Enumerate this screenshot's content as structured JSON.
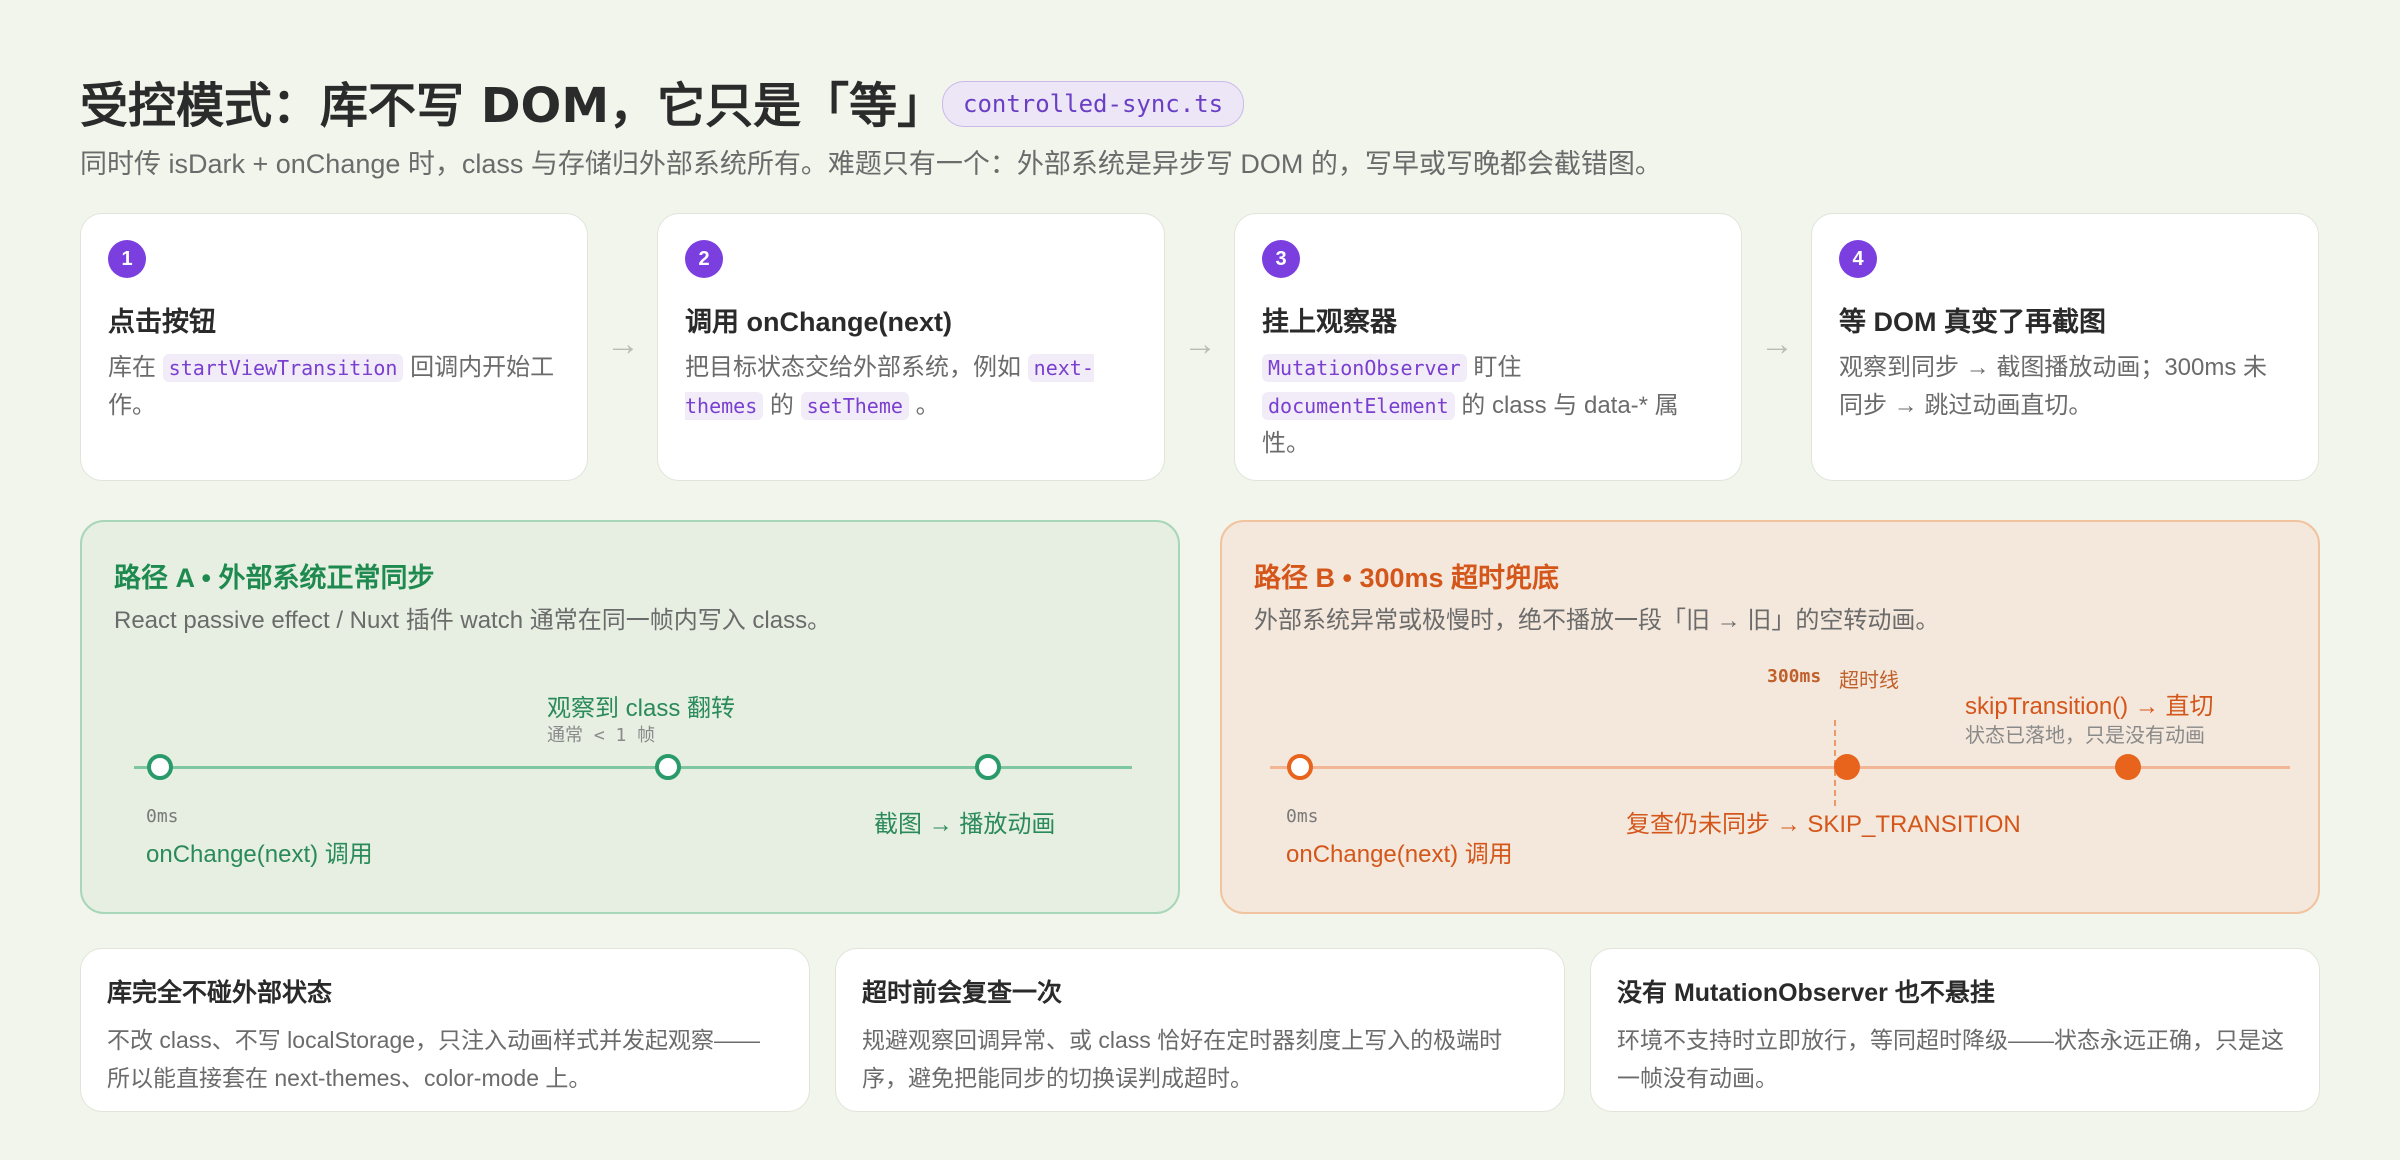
{
  "header": {
    "title": "受控模式：库不写 DOM，它只是「等」",
    "file_badge": "controlled-sync.ts",
    "subtitle": "同时传 isDark + onChange 时，class 与存储归外部系统所有。难题只有一个：外部系统是异步写 DOM 的，写早或写晚都会截错图。"
  },
  "steps": [
    {
      "num": "1",
      "title": "点击按钮",
      "desc": [
        "库在 ",
        {
          "code": "startViewTransition"
        },
        " 回调内开始工作。"
      ]
    },
    {
      "num": "2",
      "title": "调用 onChange(next)",
      "desc": [
        "把目标状态交给外部系统，例如 ",
        {
          "code": "next-themes"
        },
        " 的 ",
        {
          "code": "setTheme"
        },
        " 。"
      ]
    },
    {
      "num": "3",
      "title": "挂上观察器",
      "desc": [
        {
          "code": "MutationObserver"
        },
        " 盯住 ",
        {
          "code": "documentElement"
        },
        " 的 class 与 data-* 属性。"
      ]
    },
    {
      "num": "4",
      "title": "等 DOM 真变了再截图",
      "desc": [
        "观察到同步 → 截图播放动画；300ms 未同步 → 跳过动画直切。"
      ]
    }
  ],
  "arrow_glyph": "→",
  "path_a": {
    "title": "路径 A • 外部系统正常同步",
    "desc": "React passive effect / Nuxt 插件 watch 通常在同一帧内写入 class。",
    "start_time": "0ms",
    "start_label": "onChange(next) 调用",
    "mid_label": "观察到 class 翻转",
    "mid_sub": "通常 < 1 帧",
    "end_label": "截图 → 播放动画",
    "color": "#2a8a5a",
    "line_color": "#7fc7a0"
  },
  "path_b": {
    "title": "路径 B • 300ms 超时兜底",
    "desc": "外部系统异常或极慢时，绝不播放一段「旧 → 旧」的空转动画。",
    "timeout_mono": "300ms",
    "timeout_text": "超时线",
    "start_time": "0ms",
    "start_label": "onChange(next) 调用",
    "recheck_label": "复查仍未同步 → SKIP_TRANSITION",
    "skip_label": "skipTransition() → 直切",
    "skip_sub": "状态已落地，只是没有动画",
    "color": "#d4561a",
    "line_color": "#f2b694"
  },
  "notes": [
    {
      "title": "库完全不碰外部状态",
      "desc": "不改 class、不写 localStorage，只注入动画样式并发起观察——所以能直接套在 next-themes、color-mode 上。"
    },
    {
      "title": "超时前会复查一次",
      "desc": "规避观察回调异常、或 class 恰好在定时器刻度上写入的极端时序，避免把能同步的切换误判成超时。"
    },
    {
      "title": "没有 MutationObserver 也不悬挂",
      "desc": "环境不支持时立即放行，等同超时降级——状态永远正确，只是这一帧没有动画。"
    }
  ]
}
